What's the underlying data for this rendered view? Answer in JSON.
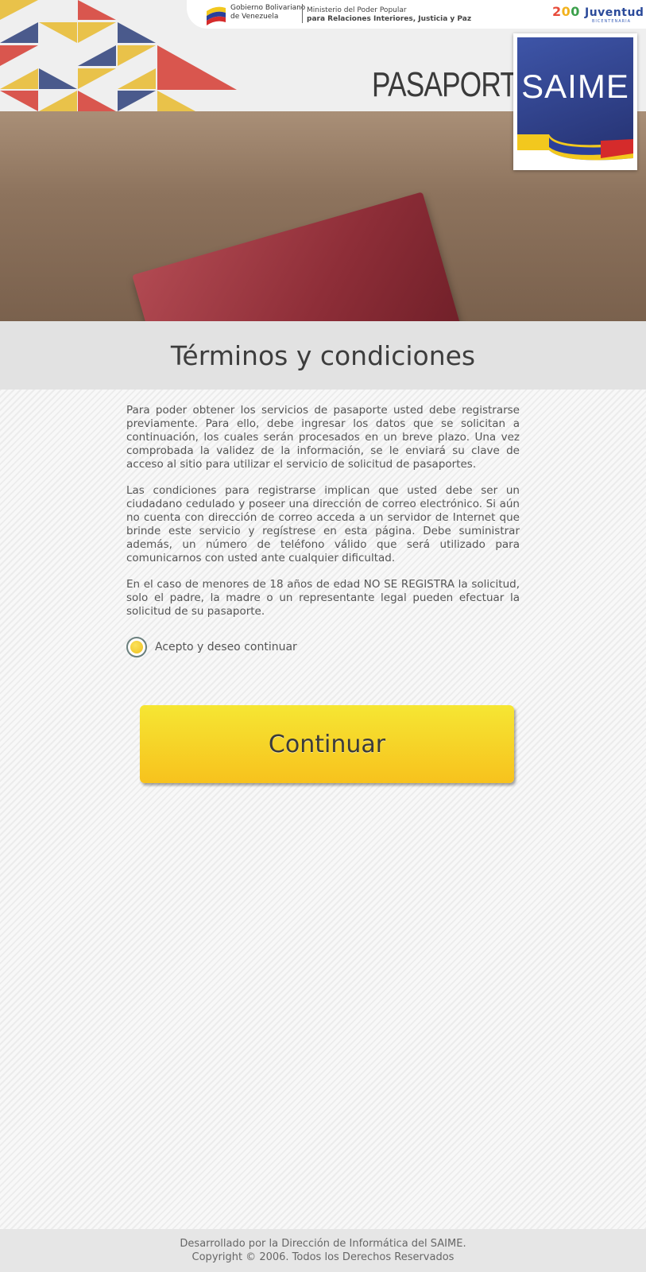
{
  "header": {
    "gov_line1": "Gobierno Bolivariano",
    "gov_line2": "de Venezuela",
    "ministry_line1": "Ministerio del Poder Popular",
    "ministry_line2": "para Relaciones Interiores, Justicia y Paz",
    "juventud_logo": "Juventud",
    "juventud_sub": "BICENTENARIA",
    "pasaporte": "PASAPORTE",
    "saime_logo": "SAIME"
  },
  "main": {
    "title": "Términos y condiciones",
    "paragraphs": [
      "Para poder obtener los servicios de pasaporte usted debe registrarse previamente. Para ello, debe ingresar los datos que se solicitan a continuación, los cuales serán procesados en un breve plazo. Una vez comprobada la validez de la información, se le enviará su clave de acceso al sitio para utilizar el servicio de solicitud de pasaportes.",
      "Las condiciones para registrarse implican que usted debe ser un ciudadano cedulado y poseer una dirección de correo electrónico. Si aún no cuenta con dirección de correo acceda a un servidor de Internet que brinde este servicio y regístrese en esta página. Debe suministrar además, un número de teléfono válido que será utilizado para comunicarnos con usted ante cualquier dificultad.",
      "En el caso de menores de 18 años de edad NO SE REGISTRA la solicitud, solo el padre, la madre o un representante legal pueden efectuar la solicitud de su pasaporte."
    ],
    "accept_label": "Acepto y deseo continuar",
    "accept_checked": true,
    "continue_button": "Continuar"
  },
  "footer": {
    "line1": "Desarrollado por la Dirección de Informática del SAIME.",
    "line2": "Copyright © 2006. Todos los Derechos Reservados"
  },
  "colors": {
    "button_yellow": "#f7c21d",
    "saime_blue": "#2f3f8a",
    "title_band": "#e2e2e2"
  }
}
